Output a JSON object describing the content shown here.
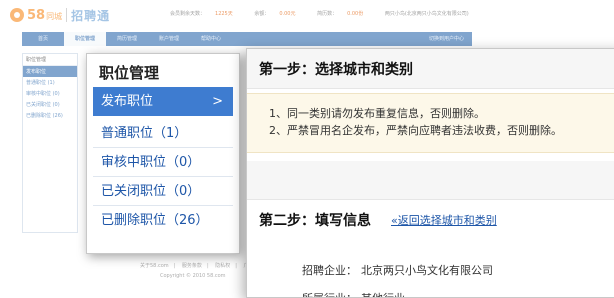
{
  "header": {
    "logo_number": "58",
    "logo_suffix": "同城",
    "logo_product": "招聘通",
    "user_info": [
      {
        "label": "会员剩余天数：",
        "value": "1225天"
      },
      {
        "label": "余额：",
        "value": "0.00元"
      },
      {
        "label": "简历数：",
        "value": "0.00份"
      },
      {
        "label": "",
        "value": "两只小鸟(北京两只小鸟文化有限公司)"
      }
    ]
  },
  "nav": {
    "items": [
      "首页",
      "职位管理",
      "简历管理",
      "账户管理",
      "帮助中心"
    ],
    "active_index": 1,
    "switch_label": "切换到用户中心"
  },
  "bg_sidebar": {
    "title": "职位管理",
    "items": [
      "发布职位",
      "普通职位 (1)",
      "审核中职位 (0)",
      "已关闭职位 (0)",
      "已删除职位 (26)"
    ],
    "active_index": 0
  },
  "menu": {
    "title": "职位管理",
    "items": [
      {
        "label": "发布职位",
        "active": true
      },
      {
        "label": "普通职位（1）",
        "active": false
      },
      {
        "label": "审核中职位（0）",
        "active": false
      },
      {
        "label": "已关闭职位（0）",
        "active": false
      },
      {
        "label": "已删除职位（26）",
        "active": false
      }
    ],
    "chevron": ">"
  },
  "form": {
    "step1_title": "第一步：选择城市和类别",
    "notices": [
      "1、同一类别请勿发布重复信息，否则删除。",
      "2、严禁冒用名企发布，严禁向应聘者违法收费，否则删除。"
    ],
    "step2_title": "第二步：填写信息",
    "back_link": "«返回选择城市和类别",
    "fields": [
      {
        "label": "招聘企业：",
        "value": "北京两只小鸟文化有限公司"
      },
      {
        "label": "所属行业：",
        "value": "其他行业"
      }
    ]
  },
  "footer": {
    "links": [
      "关于58.com",
      "服务条款",
      "隐私权",
      "广"
    ],
    "copyright": "Copyright © 2010 58.com"
  },
  "colors": {
    "brand_orange": "#f78a1d",
    "nav_blue": "#2e6aae",
    "active_blue": "#3e7cd0",
    "link_blue": "#1e56a8",
    "notice_bg": "#fdf8e9"
  },
  "icons": {
    "logo": "58-logo-icon",
    "chevron": "chevron-right-icon"
  }
}
